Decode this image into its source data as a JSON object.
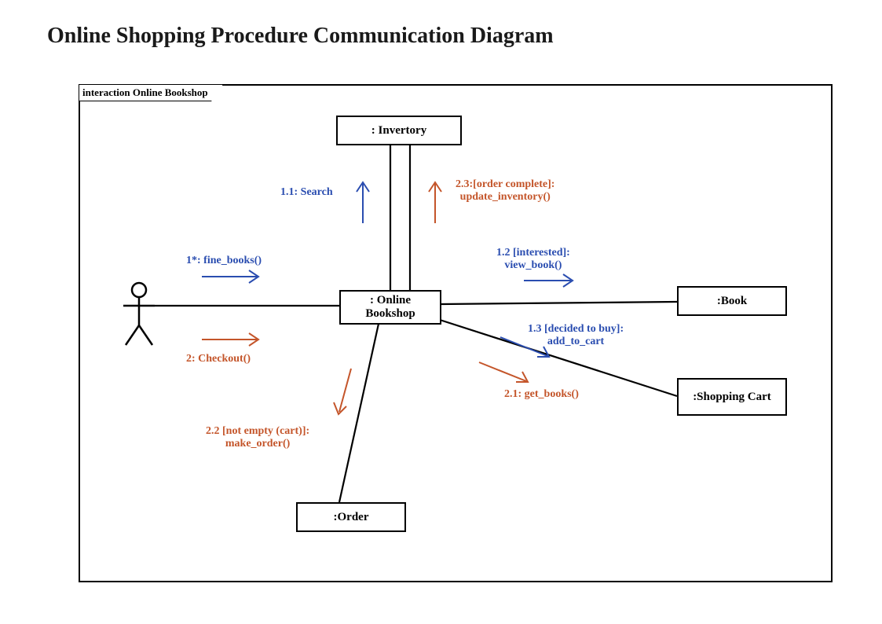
{
  "title": "Online Shopping Procedure Communication Diagram",
  "frame_label": "interaction Online Bookshop",
  "objects": {
    "inventory": ": Invertory",
    "online_bookshop": ": Online Bookshop",
    "book": ":Book",
    "shopping_cart": ":Shopping Cart",
    "order": ":Order"
  },
  "messages": {
    "m1star": "1*: fine_books()",
    "m2": "2: Checkout()",
    "m1_1": "1.1: Search",
    "m2_3_a": "2.3:[order complete]:",
    "m2_3_b": "update_inventory()",
    "m1_2_a": "1.2 [interested]:",
    "m1_2_b": "view_book()",
    "m1_3_a": "1.3 [decided to buy]:",
    "m1_3_b": "add_to_cart",
    "m2_1": "2.1: get_books()",
    "m2_2_a": "2.2 [not empty (cart)]:",
    "m2_2_b": "make_order()"
  }
}
